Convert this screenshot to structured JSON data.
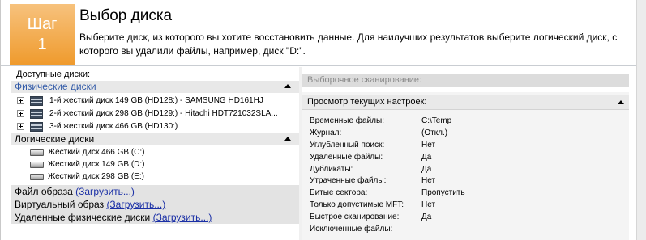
{
  "header": {
    "step_word": "Шаг",
    "step_number": "1",
    "title": "Выбор диска",
    "description": "Выберите диск, из которого вы хотите восстановить данные. Для наилучших результатов выберите логический диск, с которого вы удалили файлы, например, диск \"D:\"."
  },
  "left": {
    "available_label": "Доступные диски:",
    "physical_label": "Физические диски",
    "physical_disks": [
      "1-й жесткий диск 149 GB (HD128:) - SAMSUNG HD161HJ",
      "2-й жесткий диск 298 GB (HD129:) - Hitachi HDT721032SLA...",
      "3-й жесткий диск 466 GB (HD130:)"
    ],
    "logical_label": "Логические диски",
    "logical_disks": [
      "Жесткий диск 466 GB (C:)",
      "Жесткий диск 149 GB (D:)",
      "Жесткий диск 298 GB (E:)"
    ],
    "footer": [
      {
        "label": "Файл образа",
        "link": "(Загрузить...)"
      },
      {
        "label": "Виртуальный образ",
        "link": "(Загрузить...)"
      },
      {
        "label": "Удаленные физические диски",
        "link": "(Загрузить...)"
      }
    ]
  },
  "right": {
    "selective_scan_label": "Выборочное сканирование:",
    "settings_header": "Просмотр текущих настроек:",
    "settings": [
      {
        "name": "Временные файлы:",
        "value": "C:\\Temp"
      },
      {
        "name": "Журнал:",
        "value": "(Откл.)"
      },
      {
        "name": "Углубленный поиск:",
        "value": "Нет"
      },
      {
        "name": "Удаленные файлы:",
        "value": "Да"
      },
      {
        "name": "Дубликаты:",
        "value": "Да"
      },
      {
        "name": "Утраченные файлы:",
        "value": "Нет"
      },
      {
        "name": "Битые сектора:",
        "value": "Пропустить"
      },
      {
        "name": "Только допустимые MFT:",
        "value": "Нет"
      },
      {
        "name": "Быстрое сканирование:",
        "value": "Да"
      },
      {
        "name": "Исключенные файлы:",
        "value": ""
      }
    ]
  }
}
